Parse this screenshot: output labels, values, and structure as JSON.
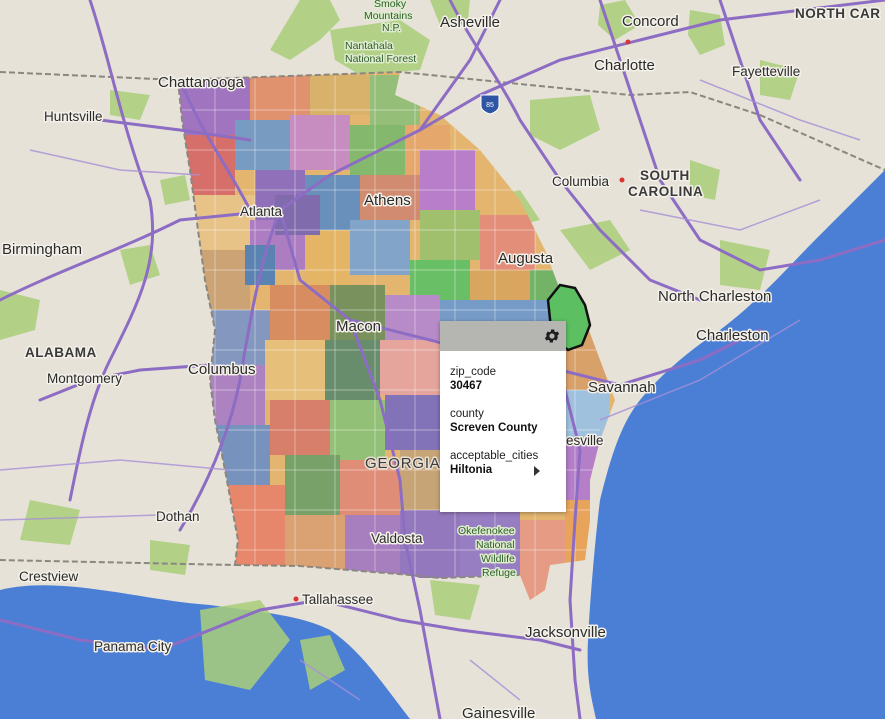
{
  "map": {
    "colors": {
      "land": "#e6e2d8",
      "water": "#4b7fd6",
      "roads": "#8d6cc4",
      "forest": "#a9cf7a",
      "border": "#8a8780"
    },
    "labels": {
      "smoky_mountains": "Smoky\nMountains\nN.P.",
      "asheville": "Asheville",
      "concord": "Concord",
      "north_carolina": "NORTH CAR",
      "charlotte": "Charlotte",
      "fayetteville": "Fayetteville",
      "nantahala": "Nantahala\nNational Forest",
      "chattanooga": "Chattanooga",
      "huntsville": "Huntsville",
      "columbia": "Columbia",
      "south_carolina": "SOUTH\nCAROLINA",
      "athens": "Athens",
      "atlanta": "Atlanta",
      "birmingham": "Birmingham",
      "augusta": "Augusta",
      "north_charleston": "North Charleston",
      "charleston": "Charleston",
      "macon": "Macon",
      "alabama": "ALABAMA",
      "montgomery": "Montgomery",
      "columbus": "Columbus",
      "savannah": "Savannah",
      "hinesville": "esville",
      "georgia": "GEORGIA",
      "dothan": "Dothan",
      "valdosta": "Valdosta",
      "okefenokee": "Okefenokee\nNational\nWildlife\nRefuge",
      "crestview": "Crestview",
      "tallahassee": "Tallahassee",
      "jacksonville": "Jacksonville",
      "panama_city": "Panama City",
      "gainesville": "Gainesville",
      "shield_85": "85"
    }
  },
  "popup": {
    "fields": [
      {
        "label": "zip_code",
        "value": "30467"
      },
      {
        "label": "county",
        "value": "Screven County"
      },
      {
        "label": "acceptable_cities",
        "value": "Hiltonia"
      }
    ]
  }
}
